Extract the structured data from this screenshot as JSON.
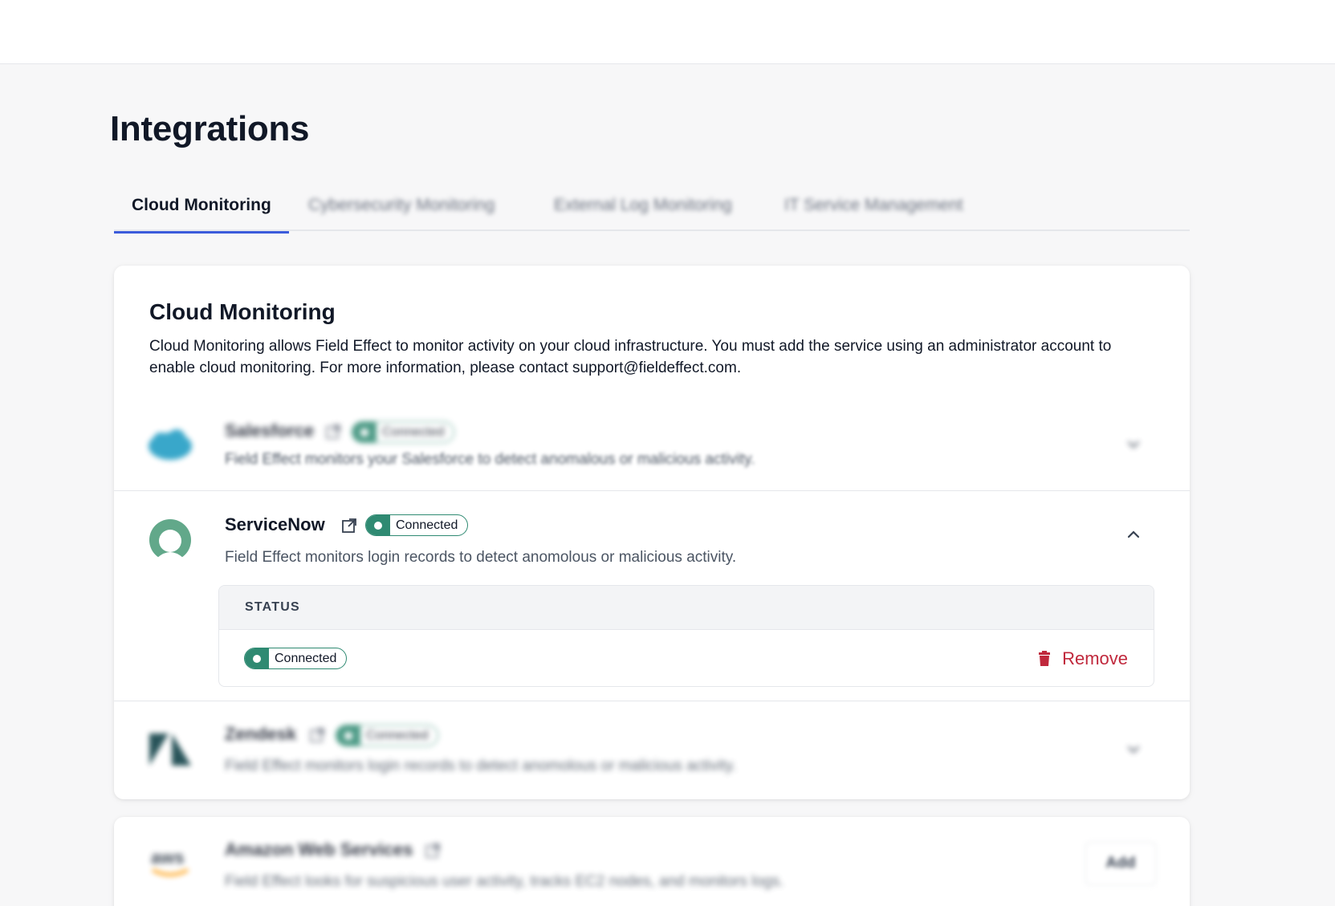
{
  "page": {
    "title": "Integrations"
  },
  "tabs": [
    {
      "label": "Cloud Monitoring",
      "active": true
    },
    {
      "label": "Cybersecurity Monitoring",
      "active": false
    },
    {
      "label": "External Log Monitoring",
      "active": false
    },
    {
      "label": "IT Service Management",
      "active": false
    }
  ],
  "section": {
    "title": "Cloud Monitoring",
    "description": "Cloud Monitoring allows Field Effect to monitor activity on your cloud infrastructure. You must add the service using an administrator account to enable cloud monitoring. For more information, please contact support@fieldeffect.com."
  },
  "integrations": [
    {
      "name": "Salesforce",
      "status": "Connected",
      "description": "Field Effect monitors your Salesforce to detect anomalous or malicious activity.",
      "expanded": false,
      "logo": "salesforce-logo"
    },
    {
      "name": "ServiceNow",
      "status": "Connected",
      "description": "Field Effect monitors login records to detect anomolous or malicious activity.",
      "expanded": true,
      "logo": "servicenow-logo",
      "details": {
        "status_header": "STATUS",
        "status_value": "Connected",
        "remove_label": "Remove"
      }
    },
    {
      "name": "Zendesk",
      "status": "Connected",
      "description": "Field Effect monitors login records to detect anomolous or malicious activity.",
      "expanded": false,
      "logo": "zendesk-logo"
    }
  ],
  "aws": {
    "name": "Amazon Web Services",
    "description": "Field Effect looks for suspicious user activity, tracks EC2 nodes, and monitors logs.",
    "add_label": "Add",
    "logo": "aws-logo"
  },
  "colors": {
    "accent": "#3b5bdb",
    "connected": "#2f8a72",
    "danger": "#c0283c",
    "salesforce": "#1798c1",
    "servicenow": "#62a88a",
    "zendesk": "#03363d",
    "aws_orange": "#ff9900"
  }
}
